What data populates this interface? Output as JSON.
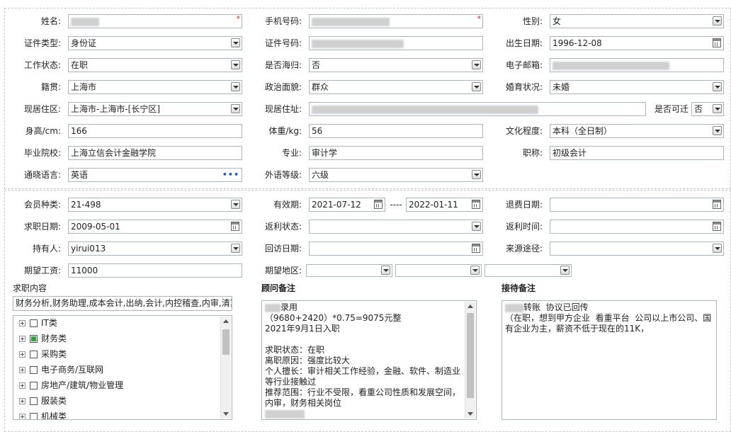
{
  "personal": {
    "name": {
      "label": "姓名:",
      "value": ""
    },
    "mobile": {
      "label": "手机号码:",
      "value": ""
    },
    "gender": {
      "label": "性别:",
      "value": "女"
    },
    "id_type": {
      "label": "证件类型:",
      "value": "身份证"
    },
    "id_number": {
      "label": "证件号码:",
      "value": ""
    },
    "birth_date": {
      "label": "出生日期:",
      "value": "1996-12-08"
    },
    "work_status": {
      "label": "工作状态:",
      "value": "在职"
    },
    "returnee": {
      "label": "是否海归:",
      "value": "否"
    },
    "email": {
      "label": "电子邮箱:",
      "value": ""
    },
    "native_place": {
      "label": "籍贯:",
      "value": "上海市"
    },
    "political": {
      "label": "政治面貌:",
      "value": "群众"
    },
    "marital": {
      "label": "婚育状况:",
      "value": "未婚"
    },
    "residence_area": {
      "label": "现居住区:",
      "value": "上海市-上海市-[长宁区]"
    },
    "residence_address": {
      "label": "现居住址:",
      "value": ""
    },
    "relocate": {
      "label": "是否可迁",
      "value": "否"
    },
    "height": {
      "label": "身高/cm:",
      "value": "166"
    },
    "weight": {
      "label": "体重/kg:",
      "value": "56"
    },
    "education": {
      "label": "文化程度:",
      "value": "本科（全日制）"
    },
    "school": {
      "label": "毕业院校:",
      "value": "上海立信会计金融学院"
    },
    "major": {
      "label": "专业:",
      "value": "审计学"
    },
    "title": {
      "label": "职称:",
      "value": "初级会计"
    },
    "language": {
      "label": "通晓语言:",
      "value": "英语"
    },
    "lang_level": {
      "label": "外语等级:",
      "value": "六级"
    }
  },
  "membership": {
    "member_type": {
      "label": "会员种类:",
      "value": "21-498"
    },
    "valid_period": {
      "label": "有效期:",
      "start": "2021-07-12",
      "sep": "----",
      "end": "2022-01-11"
    },
    "refund_date": {
      "label": "退费日期:",
      "value": ""
    },
    "job_date": {
      "label": "求职日期:",
      "value": "2009-05-01"
    },
    "rebate_status": {
      "label": "返利状态:",
      "value": ""
    },
    "rebate_time": {
      "label": "返利时间:",
      "value": ""
    },
    "holder": {
      "label": "持有人:",
      "value": "yirui013"
    },
    "visit_date": {
      "label": "回访日期:",
      "value": ""
    },
    "source": {
      "label": "来源途径:",
      "value": ""
    },
    "salary": {
      "label": "期望工资:",
      "value": "11000"
    },
    "region": {
      "label": "期望地区:",
      "v1": "",
      "v2": "",
      "v3": ""
    }
  },
  "job_content": {
    "title": "求职内容",
    "summary": "财务分析,财务助理,成本会计,出纳,会计,内控稽查,内审,清算",
    "tree": [
      {
        "label": "IT类",
        "checked": false
      },
      {
        "label": "财务类",
        "checked": true
      },
      {
        "label": "采购类",
        "checked": false
      },
      {
        "label": "电子商务/互联网",
        "checked": false
      },
      {
        "label": "房地产/建筑/物业管理",
        "checked": false
      },
      {
        "label": "服装类",
        "checked": false
      },
      {
        "label": "机械类",
        "checked": false
      }
    ]
  },
  "advisor_notes": {
    "title": "顾问备注",
    "text": "录用\n（9680+2420）*0.75=9075元整\n2021年9月1日入职\n\n求职状态：在职\n离职原因：强度比较大\n个人擅长：审计相关工作经验，金融、软件、制造业等行业接触过\n推荐范围：行业不受限，看重公司性质和发展空间，内审，财务相关岗位"
  },
  "reception_notes": {
    "title": "接待备注",
    "text": "转账  协议已回传\n（在职，想到甲方企业  看重平台  公司以上市公司、国有企业为主，薪资不低于现在的11K，"
  }
}
